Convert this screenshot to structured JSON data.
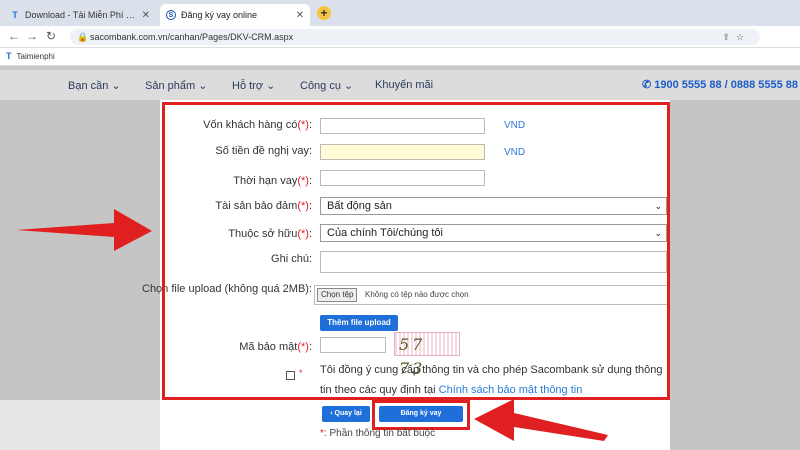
{
  "browser": {
    "tabs": [
      {
        "title": "Download - Tải Miễn Phí VN - Ph",
        "active": false
      },
      {
        "title": "Đăng ký vay online",
        "active": true
      }
    ],
    "new_tab": "+",
    "url": "sacombank.com.vn/canhan/Pages/DKV-CRM.aspx",
    "bookmark": "Taimienphi"
  },
  "site_nav": {
    "items": [
      "Bạn cần",
      "Sản phẩm",
      "Hỗ trợ",
      "Công cụ",
      "Khuyến mãi"
    ],
    "hotline": "1900 5555 88 / 0888 5555 88"
  },
  "form": {
    "required_mark": "(*)",
    "fields": {
      "von_label": "Vốn khách hàng có",
      "von_unit": "VND",
      "sotien_label": "Số tiền đề nghị vay:",
      "sotien_unit": "VND",
      "thoihan_label": "Thời hạn vay",
      "taisan_label": "Tài sản bảo đảm",
      "taisan_value": "Bất động sản",
      "thuoc_label": "Thuộc sở hữu",
      "thuoc_value": "Của chính Tôi/chúng tôi",
      "ghichu_label": "Ghi chú:",
      "file_label": "Chọn file upload (không quá 2MB):",
      "file_button": "Chọn tệp",
      "file_status": "Không có tệp nào được chọn",
      "add_file_button": "Thêm file upload",
      "mabaomat_label": "Mã bảo mật",
      "captcha_text": "57 73"
    },
    "consent_text": "Tôi đồng ý cung cấp thông tin và cho phép Sacombank sử dụng thông tin theo các quy định tại",
    "consent_link": "Chính sách bảo mật thông tin",
    "back_button": "Quay lại",
    "submit_button": "Đăng ký vay",
    "footnote_mark": "*",
    "footnote_text": ": Phần thông tin bắt buộc"
  },
  "colors": {
    "highlight": "#e02020",
    "button": "#1e6fd9",
    "link": "#2a7bd8"
  }
}
